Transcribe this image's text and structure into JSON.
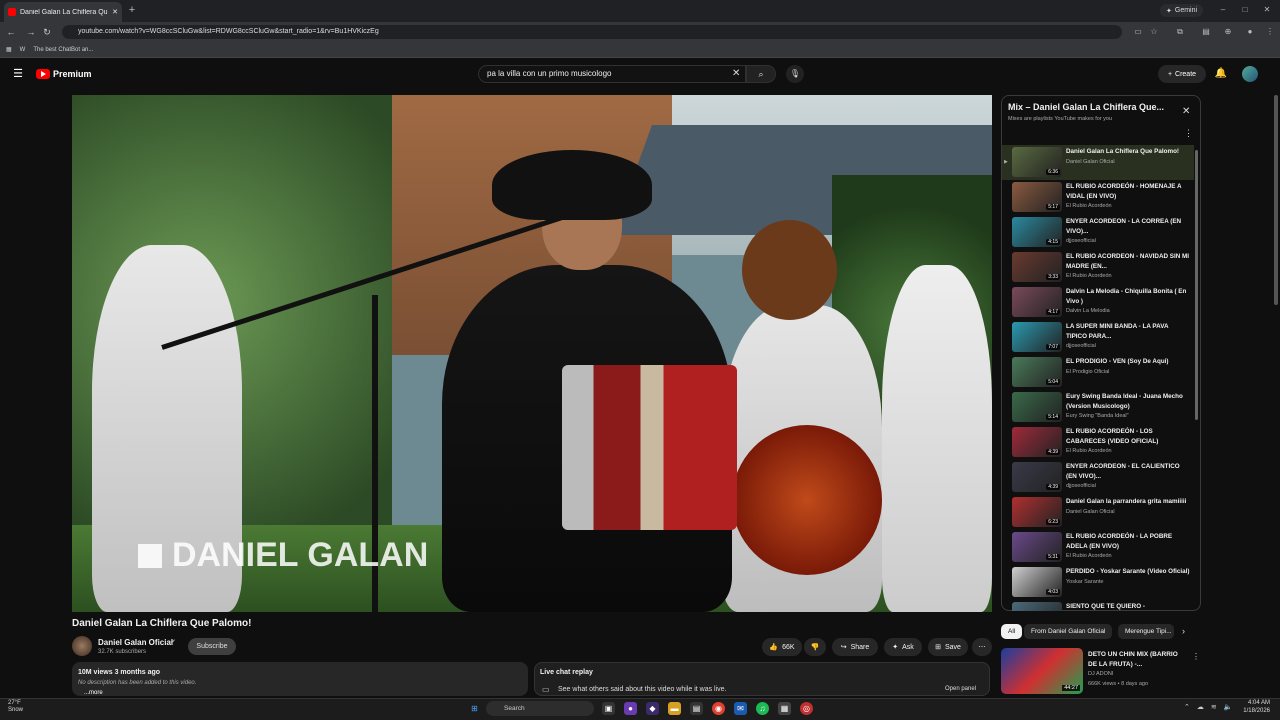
{
  "browser": {
    "tab_title": "Daniel Galan La Chiflera Qu...",
    "new_tab": "+",
    "gemini_label": "Gemini",
    "url": "youtube.com/watch?v=WG8ccSCluGw&list=RDWG8ccSCluGw&start_radio=1&rv=Bu1HVKiczEg",
    "bookmarks": [
      "W",
      "The best ChatBot an..."
    ]
  },
  "header": {
    "logo_label": "Premium",
    "search_value": "pa la villa con un primo musicologo",
    "create_label": "Create"
  },
  "video": {
    "watermark": "DANIEL GALAN",
    "title": "Daniel Galan La Chiflera Que Palomo!",
    "channel": "Daniel Galan Oficial",
    "subscribers": "32.7K subscribers",
    "subscribe_label": "Subscribe",
    "likes": "66K",
    "share_label": "Share",
    "ask_label": "Ask",
    "save_label": "Save",
    "views_line": "10M views  3 months ago",
    "no_description": "No description has been added to this video.",
    "more_label": "...more"
  },
  "live_chat": {
    "title": "Live chat replay",
    "description": "See what others said about this video while it was live.",
    "open_panel": "Open panel"
  },
  "playlist": {
    "title": "Mix – Daniel Galan La Chiflera Que...",
    "subtitle": "Mixes are playlists YouTube makes for you",
    "items": [
      {
        "title": "Daniel Galan La Chiflera Que Palomo!",
        "channel": "Daniel Galan Oficial",
        "duration": "6:36",
        "index": "▶",
        "color": "#5a6a40"
      },
      {
        "title": "EL RUBIO ACORDEÓN - HOMENAJE A VIDAL (EN VIVO)",
        "channel": "El Rubio Acordeón",
        "duration": "5:17",
        "index": "",
        "color": "#8a5a40"
      },
      {
        "title": "ENYER ACORDEON - LA CORREA (EN VIVO)...",
        "channel": "djjoseofficial",
        "duration": "4:15",
        "index": "",
        "color": "#2a8aa0"
      },
      {
        "title": "EL RUBIO ACORDEON - NAVIDAD SIN MI MADRE (EN...",
        "channel": "El Rubio Acordeón",
        "duration": "3:33",
        "index": "",
        "color": "#6a3a30"
      },
      {
        "title": "Dalvin La Melodia - Chiquilla Bonita ( En Vivo )",
        "channel": "Dalvin La Melodia",
        "duration": "4:17",
        "index": "",
        "color": "#7a4a5a"
      },
      {
        "title": "LA SUPER MINI BANDA - LA PAVA TIPICO PARA...",
        "channel": "djjoseofficial",
        "duration": "7:07",
        "index": "",
        "color": "#2a9ab0"
      },
      {
        "title": "EL PRODIGIO - VEN (Soy De Aqui)",
        "channel": "El Prodigio Oficial",
        "duration": "5:04",
        "index": "",
        "color": "#4a7a5a"
      },
      {
        "title": "Eury Swing Banda Ideal - Juana Mecho (Version Musicologo)",
        "channel": "Eury Swing \"Banda Ideal\"",
        "duration": "5:14",
        "index": "",
        "color": "#3a6a4a"
      },
      {
        "title": "EL RUBIO ACORDEÓN - LOS CABARECES (VIDEO OFICIAL)",
        "channel": "El Rubio Acordeón",
        "duration": "4:39",
        "index": "",
        "color": "#a02a3a"
      },
      {
        "title": "ENYER ACORDEON - EL CALIENTICO (EN VIVO)...",
        "channel": "djjoseofficial",
        "duration": "4:39",
        "index": "",
        "color": "#3a3a4a"
      },
      {
        "title": "Daniel Galan la parrandera grita mamiiiii",
        "channel": "Daniel Galan Oficial",
        "duration": "6:23",
        "index": "",
        "color": "#b03030"
      },
      {
        "title": "EL RUBIO ACORDEÓN - LA POBRE ADELA (EN VIVO)",
        "channel": "El Rubio Acordeón",
        "duration": "5:31",
        "index": "",
        "color": "#6a4a8a"
      },
      {
        "title": "PERDIDO - Yoskar Sarante (Video Oficial)",
        "channel": "Yoskar Sarante",
        "duration": "4:03",
        "index": "",
        "color": "#d0d0d0"
      },
      {
        "title": "SIENTO QUE TE QUIERO -",
        "channel": "",
        "duration": "",
        "index": "",
        "color": "#4a6a7a"
      }
    ]
  },
  "chips": [
    "All",
    "From Daniel Galan Oficial",
    "Merengue Tipi..."
  ],
  "recommended": {
    "title": "DETO UN CHIN MIX (BARRIO DE LA FRUTA) -...",
    "channel": "DJ ADONI",
    "meta": "666K views • 8 days ago",
    "duration": "44:27"
  },
  "taskbar": {
    "temperature": "27°F",
    "condition": "Snow",
    "search_label": "Search",
    "time": "4:04 AM",
    "date": "1/18/2026"
  }
}
